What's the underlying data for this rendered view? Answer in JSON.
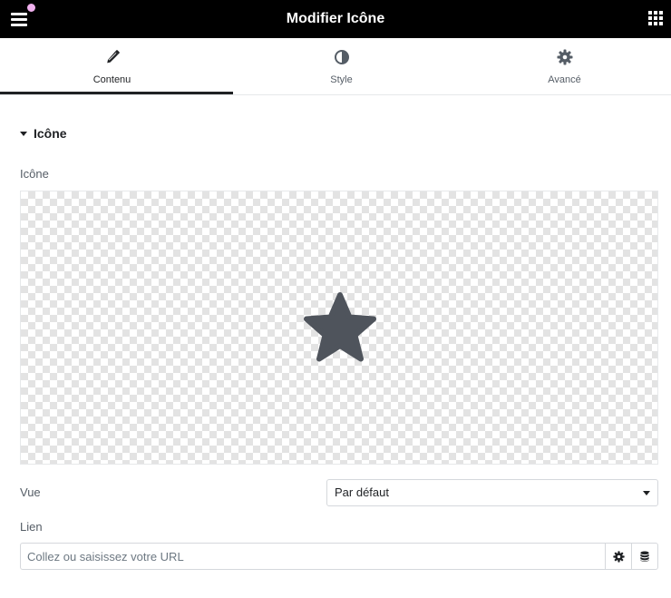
{
  "topbar": {
    "title": "Modifier Icône",
    "menu_icon": "hamburger-icon",
    "apps_icon": "grid-icon",
    "notification_color": "#f0b0ee"
  },
  "tabs": [
    {
      "label": "Contenu",
      "icon": "pencil-icon",
      "active": true
    },
    {
      "label": "Style",
      "icon": "half-circle-icon",
      "active": false
    },
    {
      "label": "Avancé",
      "icon": "gear-icon",
      "active": false
    }
  ],
  "section": {
    "title": "Icône",
    "expanded": true
  },
  "icon_field": {
    "label": "Icône",
    "selected_icon": "star-icon",
    "icon_color": "#4f545c"
  },
  "view_field": {
    "label": "Vue",
    "value": "Par défaut"
  },
  "link_field": {
    "label": "Lien",
    "placeholder": "Collez ou saisissez votre URL",
    "value": ""
  },
  "colors": {
    "topbar_bg": "#000000",
    "accent": "#1f2124"
  }
}
